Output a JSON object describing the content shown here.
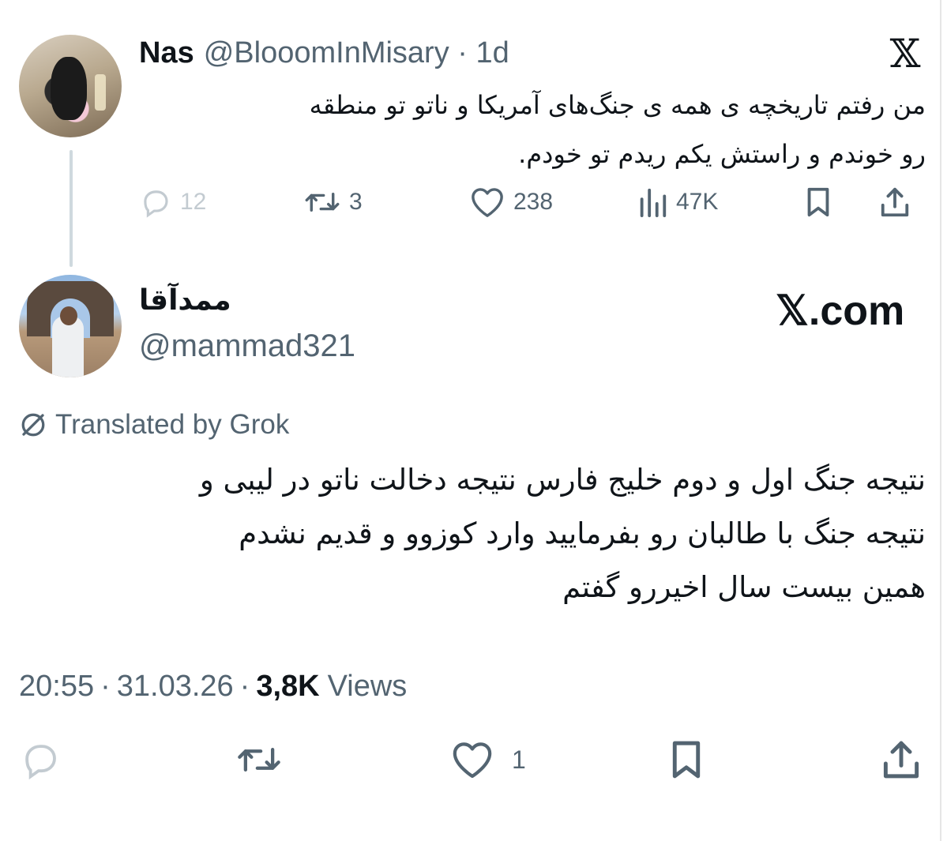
{
  "tweet1": {
    "display_name": "Nas",
    "handle": "@BlooomInMisary",
    "dot": "·",
    "time_ago": "1d",
    "text_line1": "من رفتم تاریخچه ی همه ی جنگ‌های آمریکا و ناتو تو منطقه",
    "text_line2": "رو خوندم و راستش یکم ریدم تو خودم.",
    "logo": "𝕏",
    "actions": {
      "reply_count": "12",
      "retweet_count": "3",
      "like_count": "238",
      "views_count": "47K"
    },
    "icons": [
      "reply-icon",
      "retweet-icon",
      "heart-icon",
      "views-icon",
      "bookmark-icon",
      "share-icon"
    ]
  },
  "tweet2": {
    "display_name": "ممدآقا",
    "handle": "@mammad321",
    "watermark": "𝕏.com",
    "translated_label": "Translated by Grok",
    "text_line1": "نتیجه جنگ اول و دوم خلیج فارس نتیجه دخالت ناتو در لیبی و",
    "text_line2": "نتیجه جنگ با طالبان رو بفرمایید وارد کوزوو و قدیم نشدم",
    "text_line3": "همین بیست سال اخیررو گفتم",
    "meta": {
      "time": "20:55",
      "sep": "·",
      "date": "31.03.26",
      "views_number": "3,8K",
      "views_label": "Views"
    },
    "actions": {
      "like_count": "1"
    }
  },
  "colors": {
    "text": "#0f1419",
    "secondary": "#536471",
    "faded": "#c3cbd1",
    "thread_line": "#cfd9de"
  }
}
